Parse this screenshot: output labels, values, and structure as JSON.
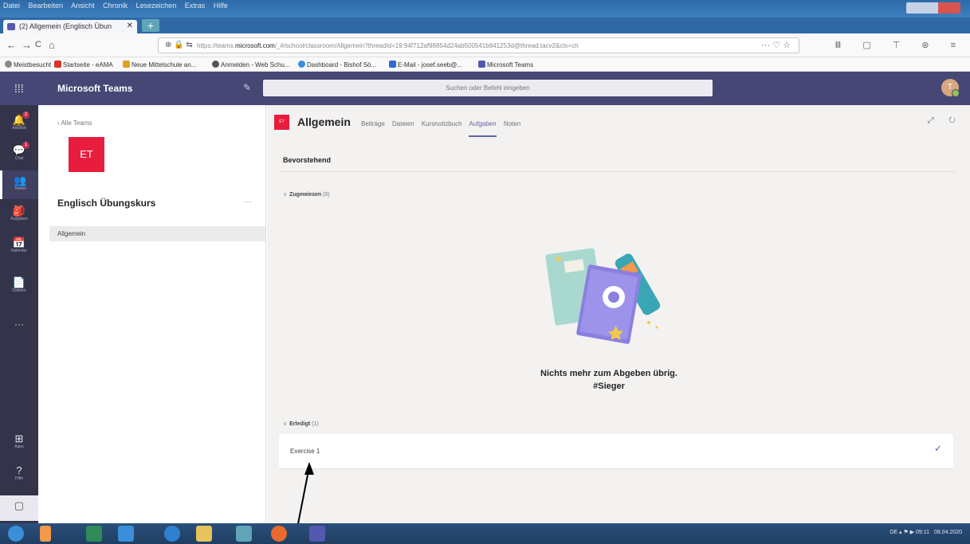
{
  "browser": {
    "menus": [
      "Datei",
      "Bearbeiten",
      "Ansicht",
      "Chronik",
      "Lesezeichen",
      "Extras",
      "Hilfe"
    ],
    "tab_title": "(2) Allgemein (Englisch Übun",
    "tab_close": "✕",
    "new_tab": "+",
    "url_prefix": "https://teams.",
    "url_host": "microsoft.com",
    "url_rest": "/_#/school/classroom/Allgemein?threadId=19:94f712af98854d24ab500541b841253d@thread.tacv2&ctx=ch",
    "url_lock": "⊕ 🔒 ⇆",
    "url_actions": "··· ♡ ☆",
    "back": "←",
    "forward": "→",
    "reload": "C",
    "home": "⌂",
    "toolbar_icons": "Ⅲ ▢ ⊤ ⊛ ≡",
    "bookmarks": [
      {
        "label": "Meistbesucht",
        "color": "#888888"
      },
      {
        "label": "Startseite - eAMA",
        "color": "#d9342b"
      },
      {
        "label": "Neue Mittelschule an...",
        "color": "#e0a020"
      },
      {
        "label": "Anmelden - Web Schu...",
        "color": "#555555"
      },
      {
        "label": "Dashboard - Bishof Sö...",
        "color": "#3a8fd8"
      },
      {
        "label": "E-Mail - josef.seeb@...",
        "color": "#2f6bd0"
      },
      {
        "label": "Microsoft Teams",
        "color": "#5558af"
      }
    ]
  },
  "teams": {
    "app_title": "Microsoft Teams",
    "waffle": "⁞⁞⁞",
    "compose": "✎",
    "search_placeholder": "Suchen oder Befehl eingeben",
    "avatar_initial": "T",
    "rail": [
      {
        "label": "Aktivität",
        "icon": "🔔",
        "badge": "2"
      },
      {
        "label": "Chat",
        "icon": "💬",
        "badge": "1"
      },
      {
        "label": "Teams",
        "icon": "👥",
        "badge": ""
      },
      {
        "label": "Aufgaben",
        "icon": "🎒",
        "badge": ""
      },
      {
        "label": "Kalender",
        "icon": "📅",
        "badge": ""
      },
      {
        "label": "Dateien",
        "icon": "📄",
        "badge": ""
      }
    ],
    "rail_more": "···",
    "rail_bottom": [
      {
        "label": "Apps",
        "icon": "⊞"
      },
      {
        "label": "Hilfe",
        "icon": "?"
      }
    ],
    "rail_feedback": "▢"
  },
  "team_panel": {
    "back_label": "‹  Alle Teams",
    "tile_initials": "ET",
    "team_name": "Englisch Übungskurs",
    "more": "···",
    "channel": "Allgemein"
  },
  "channel": {
    "icon_text": "ET",
    "title": "Allgemein",
    "tabs": [
      "Beiträge",
      "Dateien",
      "Kursnotizbuch",
      "Aufgaben",
      "Noten"
    ],
    "active_tab": "Aufgaben",
    "header_icons": "⤢ ↻",
    "section_title": "Bevorstehend",
    "assigned_label": "Zugewiesen",
    "assigned_count": "(0)",
    "empty_line1": "Nichts mehr zum Abgeben übrig.",
    "empty_line2": "#Sieger",
    "done_label": "Erledigt",
    "done_count": "(1)",
    "assignments": [
      {
        "name": "Exercise 1",
        "status_icon": "✓"
      }
    ]
  },
  "taskbar": {
    "tray_text": "DE  ▴  ⚑  ▶     09:11",
    "date": "08.04.2020"
  }
}
